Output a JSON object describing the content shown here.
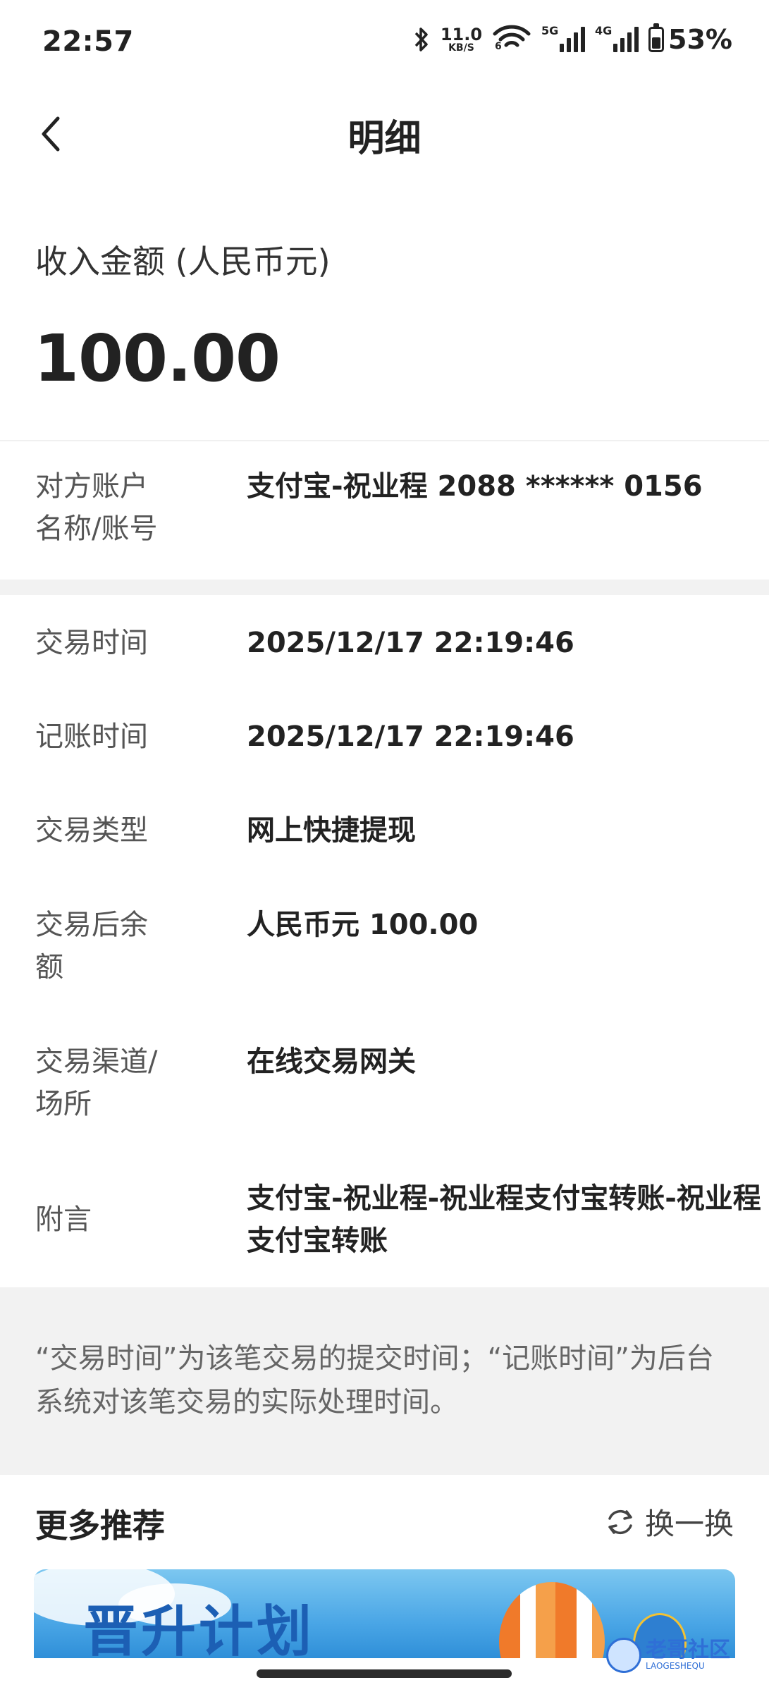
{
  "status_bar": {
    "time": "22:57",
    "net_speed_value": "11.0",
    "net_speed_unit": "KB/S",
    "wifi_tag": "6",
    "signal1_tag": "5G",
    "signal2_tag": "4G",
    "battery": "53%",
    "battery_level": 0.53,
    "icons": [
      "bluetooth-icon",
      "wifi-icon",
      "signal-5g-icon",
      "signal-4g-icon",
      "battery-icon"
    ]
  },
  "header": {
    "title": "明细",
    "back_icon": "chevron-left-icon"
  },
  "summary": {
    "amount_label": "收入金额 (人民币元)",
    "amount": "100.00"
  },
  "counterparty": {
    "label": "对方账户\n名称/账号",
    "value": "支付宝-祝业程 2088 ****** 0156"
  },
  "details": [
    {
      "label": "交易时间",
      "value": "2025/12/17 22:19:46"
    },
    {
      "label": "记账时间",
      "value": "2025/12/17 22:19:46"
    },
    {
      "label": "交易类型",
      "value": "网上快捷提现"
    },
    {
      "label": "交易后余\n额",
      "value": "人民币元 100.00"
    },
    {
      "label": "交易渠道/\n场所",
      "value": "在线交易网关"
    },
    {
      "label": "附言",
      "value": "支付宝-祝业程-祝业程支付宝转账-祝业程支付宝转账"
    }
  ],
  "note": "“交易时间”为该笔交易的提交时间；“记账时间”为后台系统对该笔交易的实际处理时间。",
  "more": {
    "title": "更多推荐",
    "refresh_label": "换一换",
    "refresh_icon": "refresh-icon"
  },
  "banner": {
    "text": "晋升计划"
  },
  "watermark": {
    "text": "老哥社区",
    "sub": "LAOGESHEQU"
  },
  "colors": {
    "background": "#ffffff",
    "section_gray": "#f2f2f2",
    "text_primary": "#222222",
    "text_secondary": "#555555",
    "banner_blue": "#4aa6e6"
  }
}
